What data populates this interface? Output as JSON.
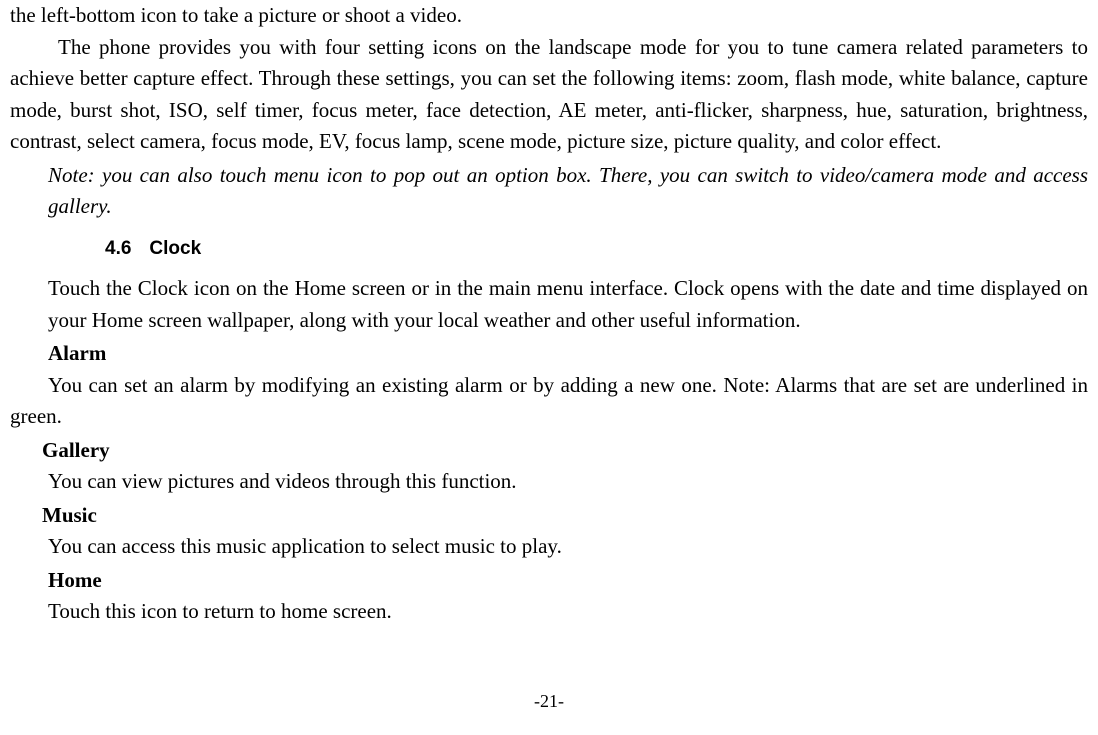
{
  "page": {
    "continuation_line": "the left-bottom icon to take a picture or shoot a video.",
    "camera_paragraph": "The phone provides you with four setting icons on the landscape mode for you to tune camera related parameters to achieve better capture effect. Through these settings, you can set the following items: zoom, flash mode, white balance, capture mode, burst shot, ISO, self timer, focus meter, face detection, AE meter, anti-flicker, sharpness, hue, saturation, brightness, contrast, select camera, focus mode, EV, focus lamp, scene mode, picture size, picture quality, and color effect.",
    "note_text": "Note: you can also touch menu icon to pop out an option box. There, you can switch to video/camera mode and access gallery.",
    "section": {
      "number": "4.6",
      "title": "Clock"
    },
    "clock_intro": "Touch the Clock icon on the Home screen or in the main menu interface. Clock opens with the date and time displayed on your Home screen wallpaper, along with your local weather and other useful information.",
    "alarm": {
      "heading": "Alarm",
      "text": "You can set an alarm by modifying an existing alarm or by adding a new one. Note: Alarms that are set are underlined in green."
    },
    "gallery": {
      "heading": "Gallery",
      "text": "You can view pictures and videos through this function."
    },
    "music": {
      "heading": "Music",
      "text": "You can access this music application to select music to play."
    },
    "home": {
      "heading": "Home",
      "text": "Touch this icon to return to home screen."
    },
    "page_number": "-21-"
  }
}
